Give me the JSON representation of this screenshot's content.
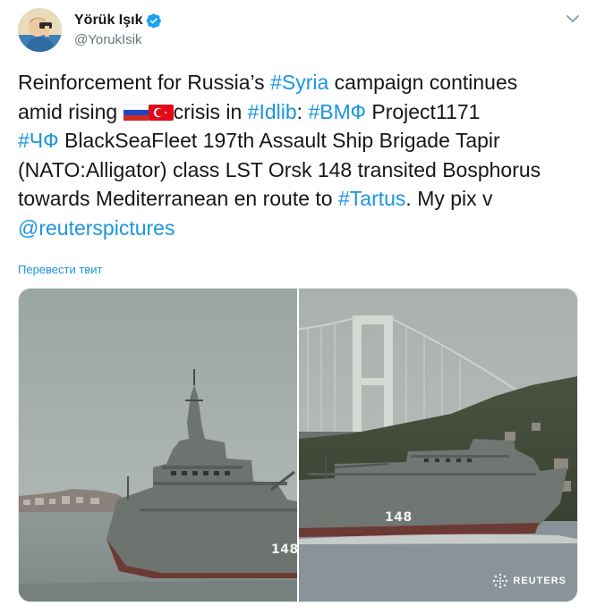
{
  "author": {
    "display_name": "Yörük Işık",
    "handle": "@YorukIsik",
    "verified": true
  },
  "tweet": {
    "lines": [
      [
        {
          "text": "Reinforcement for Russia’s ",
          "type": "text"
        },
        {
          "text": "#Syria",
          "type": "hashtag"
        },
        {
          "text": " campaign continues",
          "type": "text"
        }
      ],
      [
        {
          "text": "amid rising ",
          "type": "text"
        },
        {
          "flag": "russia"
        },
        {
          "flag": "turkey"
        },
        {
          "text": "crisis in ",
          "type": "text"
        },
        {
          "text": "#Idlib",
          "type": "hashtag"
        },
        {
          "text": ": ",
          "type": "text"
        },
        {
          "text": "#ВМФ",
          "type": "hashtag"
        },
        {
          "text": " Project1171",
          "type": "text"
        }
      ],
      [
        {
          "text": "#ЧФ",
          "type": "hashtag"
        },
        {
          "text": " BlackSeaFleet 197th Assault Ship Brigade Tapir",
          "type": "text"
        }
      ],
      [
        {
          "text": "(NATO:Alligator) class LST Orsk 148 transited Bosphorus",
          "type": "text"
        }
      ],
      [
        {
          "text": "towards Mediterranean en route to ",
          "type": "text"
        },
        {
          "text": "#Tartus",
          "type": "hashtag"
        },
        {
          "text": ". My pix v",
          "type": "text"
        }
      ],
      [
        {
          "text": "@reuterspictures",
          "type": "mention"
        }
      ]
    ]
  },
  "translate_label": "Перевести твит",
  "media": {
    "photo1": {
      "hull_number": "148"
    },
    "photo2": {
      "hull_number": "148",
      "watermark": "REUTERS"
    }
  },
  "colors": {
    "link": "#1b95e0",
    "verified": "#1da1f2",
    "secondary_text": "#657786"
  }
}
